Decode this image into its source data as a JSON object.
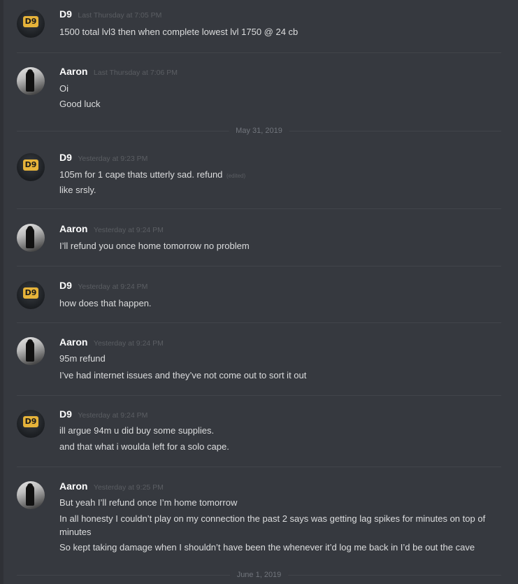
{
  "date_dividers": [
    "May 31, 2019",
    "June 1, 2019"
  ],
  "messages": [
    {
      "author": "D9",
      "timestamp": "Last Thursday at 7:05 PM",
      "lines": [
        "1500 total lvl3 then when complete lowest lvl 1750 @ 24 cb"
      ]
    },
    {
      "author": "Aaron",
      "timestamp": "Last Thursday at 7:06 PM",
      "lines": [
        "Oi",
        "Good luck"
      ]
    },
    {
      "author": "D9",
      "timestamp": "Yesterday at 9:23 PM",
      "lines": [
        "105m for 1 cape thats utterly sad. refund",
        "like srsly."
      ],
      "edited_label": "(edited)"
    },
    {
      "author": "Aaron",
      "timestamp": "Yesterday at 9:24 PM",
      "lines": [
        "I’ll refund you once home tomorrow no problem"
      ]
    },
    {
      "author": "D9",
      "timestamp": "Yesterday at 9:24 PM",
      "lines": [
        "how does that happen."
      ]
    },
    {
      "author": "Aaron",
      "timestamp": "Yesterday at 9:24 PM",
      "lines": [
        "95m refund",
        "I’ve had internet issues and they’ve not come out to sort it out"
      ]
    },
    {
      "author": "D9",
      "timestamp": "Yesterday at 9:24 PM",
      "lines": [
        "ill argue 94m u did buy some supplies.",
        "and that what i woulda left for a solo cape."
      ]
    },
    {
      "author": "Aaron",
      "timestamp": "Yesterday at 9:25 PM",
      "lines": [
        "But yeah I’ll refund once I’m home tomorrow",
        "In all honesty I couldn’t play on my connection the past 2 says was getting lag spikes for minutes on top of minutes",
        "So kept taking damage when I shouldn’t have been the whenever it’d log me back in I’d be out the cave"
      ]
    }
  ],
  "avatars": {
    "d9": {
      "badge": "D9",
      "icon": "d9-avatar-icon"
    },
    "aaron": {
      "icon": "aaron-photo-avatar"
    }
  }
}
